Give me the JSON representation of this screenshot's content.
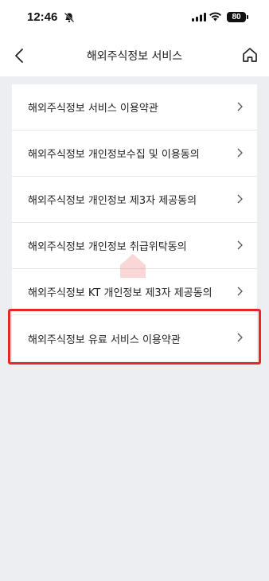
{
  "status_bar": {
    "time": "12:46",
    "battery": "80"
  },
  "header": {
    "title": "해외주식정보 서비스"
  },
  "menu": {
    "items": [
      {
        "label": "해외주식정보 서비스 이용약관"
      },
      {
        "label": "해외주식정보 개인정보수집 및 이용동의"
      },
      {
        "label": "해외주식정보 개인정보 제3자 제공동의"
      },
      {
        "label": "해외주식정보 개인정보 취급위탁동의"
      },
      {
        "label": "해외주식정보 KT 개인정보 제3자 제공동의"
      },
      {
        "label": "해외주식정보 유료 서비스 이용약관"
      }
    ]
  },
  "colors": {
    "highlight": "#e8262a",
    "background": "#eceef1"
  },
  "icons": [
    "bell-off-icon",
    "signal-icon",
    "wifi-icon",
    "battery-icon",
    "back-icon",
    "home-icon",
    "chevron-right-icon"
  ]
}
